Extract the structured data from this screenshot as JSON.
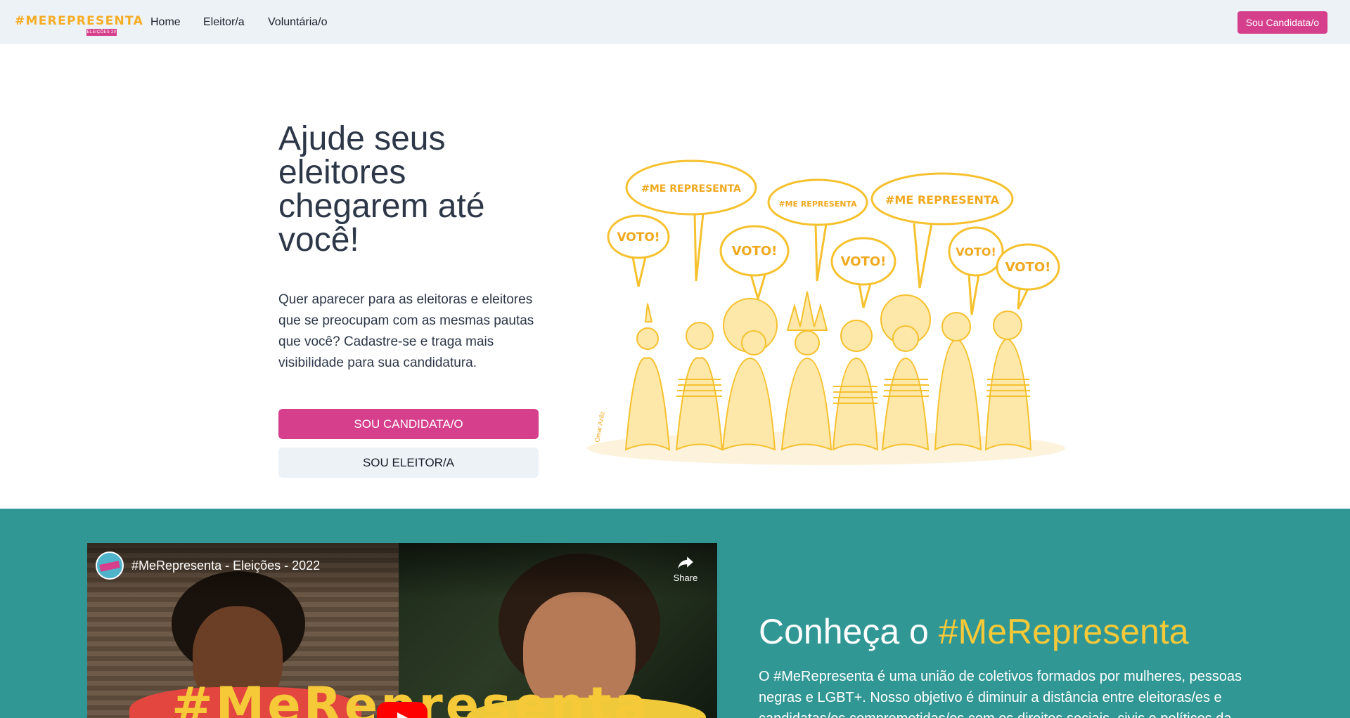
{
  "navbar": {
    "logo_text": "#MEREPRESENTA",
    "logo_sub": "ELEIÇÕES 20",
    "links": [
      {
        "label": "Home"
      },
      {
        "label": "Eleitor/a"
      },
      {
        "label": "Voluntária/o"
      }
    ],
    "cta_label": "Sou Candidata/o"
  },
  "hero": {
    "title": "Ajude seus eleitores chegarem até você!",
    "text": "Quer aparecer para as eleitoras e eleitores que se preocupam com as mesmas pautas que você? Cadastre-se e traga mais visibilidade para sua candidatura.",
    "primary_button": "SOU CANDIDATA/O",
    "secondary_button": "SOU ELEITOR/A",
    "illustration": {
      "speech_bubbles": [
        "#ME REPRESENTA",
        "#ME REPRESENTA",
        "#ME REPRESENTA",
        "VOTO!",
        "VOTO!",
        "VOTO!",
        "VOTO!",
        "VOTO!"
      ],
      "signature": "Omar Azêz"
    }
  },
  "about": {
    "video": {
      "title": "#MeRepresenta - Eleições - 2022",
      "share_label": "Share",
      "banner_text": "#MeRepresenta"
    },
    "title_prefix": "Conheça o ",
    "title_brand": "#MeRepresenta",
    "text": "O #MeRepresenta é uma união de coletivos formados por mulheres, pessoas negras e LGBT+. Nosso objetivo é diminuir a distância entre eleitoras/es e candidatas/os comprometidas/os com os direitos sociais, civis e políticos da"
  },
  "colors": {
    "brand_pink": "#d53f8c",
    "teal": "#319795",
    "yellow": "#f6c938",
    "nav_bg": "#edf2f7"
  }
}
